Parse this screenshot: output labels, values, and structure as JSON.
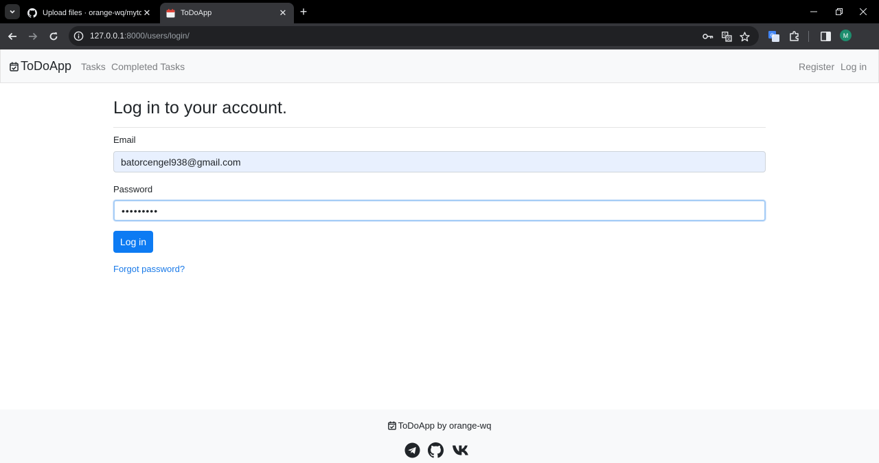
{
  "browser": {
    "tabs": [
      {
        "title": "Upload files · orange-wq/mytod",
        "active": false,
        "icon": "github-icon"
      },
      {
        "title": "ToDoApp",
        "active": true,
        "icon": "calendar-icon"
      }
    ],
    "url_host": "127.0.0.1",
    "url_path": ":8000/users/login/",
    "profile_initial": "M"
  },
  "navbar": {
    "brand": "ToDoApp",
    "links": [
      "Tasks",
      "Completed Tasks"
    ],
    "right_links": [
      "Register",
      "Log in"
    ]
  },
  "form": {
    "title": "Log in to your account.",
    "email_label": "Email",
    "email_value": "batorcengel938@gmail.com",
    "password_label": "Password",
    "password_value": "•••••••••",
    "submit_label": "Log in",
    "forgot_label": "Forgot password?"
  },
  "footer": {
    "text": "ToDoApp by orange-wq",
    "social": [
      "telegram-icon",
      "github-icon",
      "vk-icon"
    ]
  },
  "colors": {
    "primary": "#0d7bf3",
    "link": "#1a7ae8",
    "navbar_bg": "#f8f9fa",
    "autofill_bg": "#e8f0fe",
    "chrome_bg": "#35363a"
  }
}
